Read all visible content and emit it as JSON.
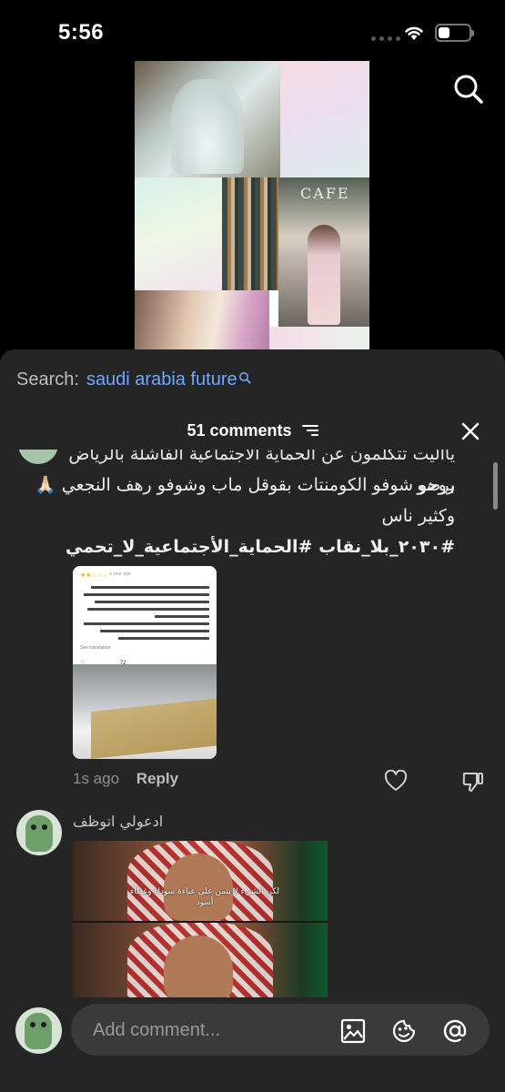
{
  "status_bar": {
    "time": "5:56"
  },
  "sheet": {
    "search_label": "Search:",
    "search_query": "saudi arabia future",
    "comment_count_label": "51 comments"
  },
  "comment1": {
    "text_line0": "يااليت تتكلمون عن الحماية الاجتماعية الفاشلة بالرياض برضو",
    "text_line1": "روحو شوفو الكومنتات بقوقل ماب وشوفو رهف النجعي",
    "text_line1_emoji": "🙏🏻",
    "text_line2": "وكثير ناس",
    "text_line3": "#٢٠٣٠_بلا_نقاب  #الحماية_الأجتماعية_لا_تحمي",
    "screenshot": {
      "date": "a year ago",
      "see_translation": "See translation",
      "likes": "72"
    },
    "time": "1s ago",
    "reply_label": "Reply"
  },
  "comment2": {
    "username": "ادعولي اتوظف",
    "video_caption": "لكن الشيء لا يتمن على عباءة سوداء وغطاء أسود"
  },
  "input_bar": {
    "placeholder": "Add comment..."
  },
  "icons": [
    "search-icon",
    "filter-icon",
    "close-icon",
    "heart-icon",
    "dislike-icon",
    "image-icon",
    "emoji-icon",
    "mention-icon"
  ]
}
